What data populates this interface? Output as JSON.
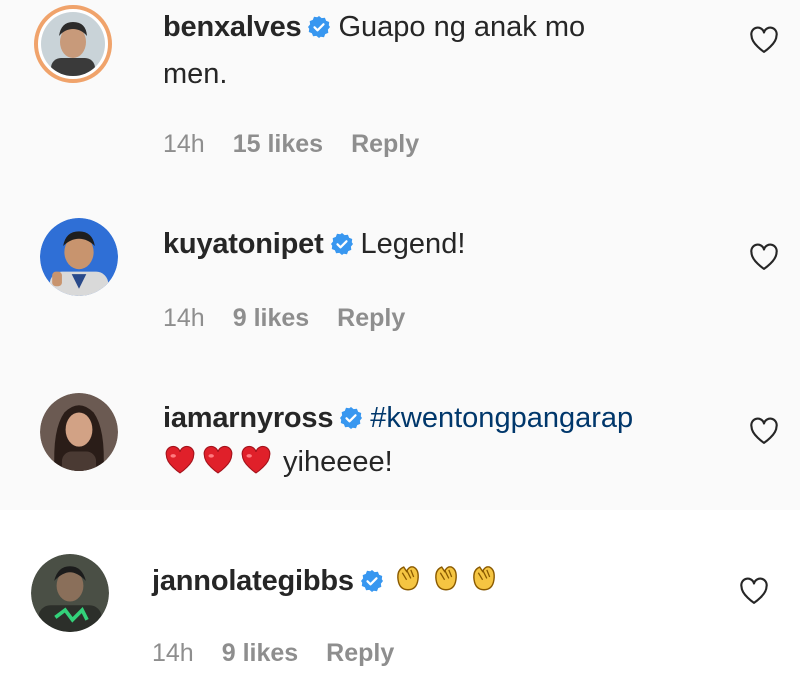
{
  "comments": [
    {
      "username": "benxalves",
      "text_line1": "Guapo ng anak mo",
      "text_line2": "men.",
      "time": "14h",
      "likes": "15 likes",
      "reply": "Reply",
      "avatar_colors": {
        "bg": "#c9d3d8",
        "skin": "#c89a7a",
        "hair": "#2b2b2b",
        "shirt": "#3a3a3a"
      }
    },
    {
      "username": "kuyatonipet",
      "text_line1": "Legend!",
      "time": "14h",
      "likes": "9 likes",
      "reply": "Reply",
      "avatar_colors": {
        "bg": "#2f6fd6",
        "skin": "#c8946e",
        "hair": "#1e1e1e",
        "shirt": "#d9d9d9"
      }
    },
    {
      "username": "iamarnyross",
      "hashtag": "#kwentongpangarap",
      "text_line2": "yiheeee!",
      "emoji": [
        "red-heart",
        "red-heart",
        "red-heart"
      ],
      "avatar_colors": {
        "bg": "#6b5a52",
        "skin": "#d2a285",
        "hair": "#2a1d18",
        "shirt": "#4a3a33"
      }
    },
    {
      "username": "jannolategibbs",
      "emoji": [
        "clapping-hands",
        "clapping-hands",
        "clapping-hands"
      ],
      "time": "14h",
      "likes": "9 likes",
      "reply": "Reply",
      "avatar_colors": {
        "bg": "#4a4f45",
        "skin": "#8a6f5a",
        "hair": "#1c1c1c",
        "shirt": "#2c2f2a"
      }
    }
  ],
  "icons": {
    "verified": "verified-badge-icon",
    "like": "heart-outline-icon"
  },
  "colors": {
    "verified": "#3897f0",
    "meta": "#8e8e8e",
    "heart_emoji": "#e0202a",
    "clap_emoji": "#f5c542",
    "avatar_ring": "#f0a36b"
  }
}
